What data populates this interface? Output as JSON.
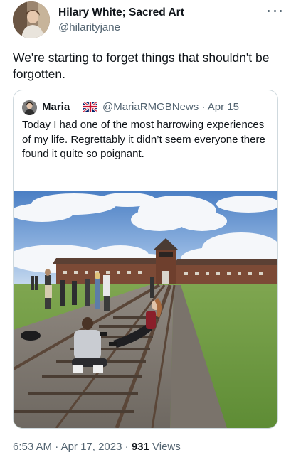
{
  "author": {
    "name": "Hilary White; Sacred Art",
    "handle": "@hilarityjane",
    "avatar_icon": "profile-photo-icon"
  },
  "tweet": {
    "text": "We're starting to forget things that shouldn't be forgotten."
  },
  "quoted": {
    "name": "Maria",
    "flag_icon": "uk-flag-icon",
    "handle": "@MariaRMGBNews",
    "sep": "·",
    "date": "Apr 15",
    "text": "Today I had one of the most harrowing experiences of my life. Regrettably it didn’t seem everyone there found it quite so poignant.",
    "photo_icon": "auschwitz-railway-photo"
  },
  "meta": {
    "time": "6:53 AM",
    "sep1": "·",
    "date": "Apr 17, 2023",
    "sep2": "·",
    "views_count": "931",
    "views_label": "Views"
  },
  "colors": {
    "text": "#0f1419",
    "secondary": "#536471",
    "border": "#cfd9de"
  }
}
